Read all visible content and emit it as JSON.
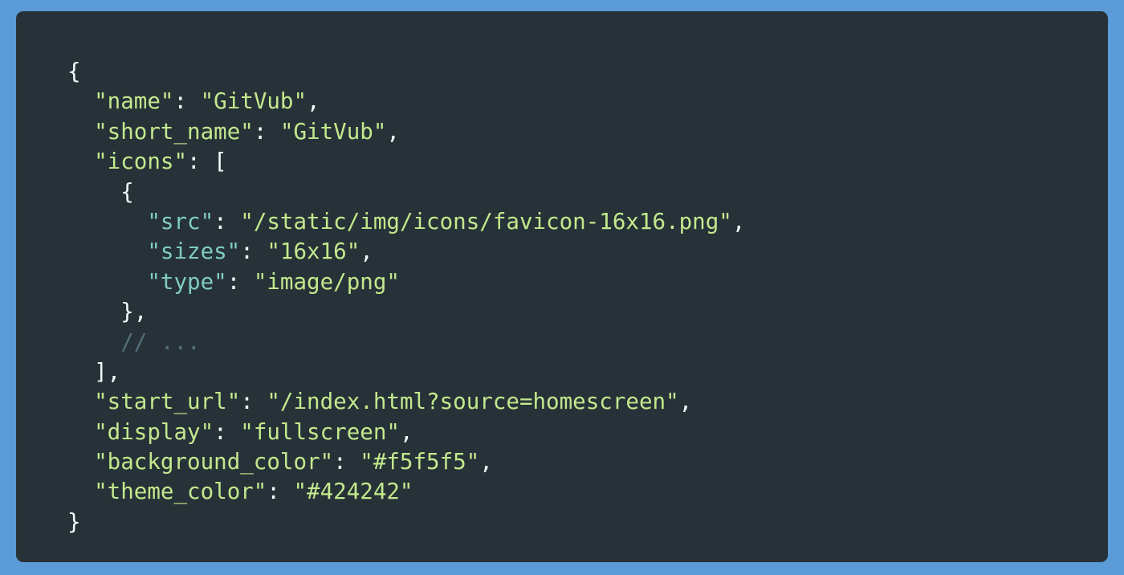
{
  "colors": {
    "page_background": "#5b9bd8",
    "panel_background": "#263238",
    "punctuation": "#eeffff",
    "key": "#c3e88d",
    "nested_key": "#80cbc4",
    "string": "#c3e88d",
    "comment": "#546e7a"
  },
  "code": {
    "open_brace": "{",
    "name_key": "\"name\"",
    "name_value": "\"GitVub\"",
    "short_name_key": "\"short_name\"",
    "short_name_value": "\"GitVub\"",
    "icons_key": "\"icons\"",
    "icons_open": "[",
    "icon_open": "{",
    "src_key": "\"src\"",
    "src_value": "\"/static/img/icons/favicon-16x16.png\"",
    "sizes_key": "\"sizes\"",
    "sizes_value": "\"16x16\"",
    "type_key": "\"type\"",
    "type_value": "\"image/png\"",
    "icon_close": "},",
    "comment": "// ...",
    "icons_close": "],",
    "start_url_key": "\"start_url\"",
    "start_url_value": "\"/index.html?source=homescreen\"",
    "display_key": "\"display\"",
    "display_value": "\"fullscreen\"",
    "background_color_key": "\"background_color\"",
    "background_color_value": "\"#f5f5f5\"",
    "theme_color_key": "\"theme_color\"",
    "theme_color_value": "\"#424242\"",
    "close_brace": "}"
  }
}
